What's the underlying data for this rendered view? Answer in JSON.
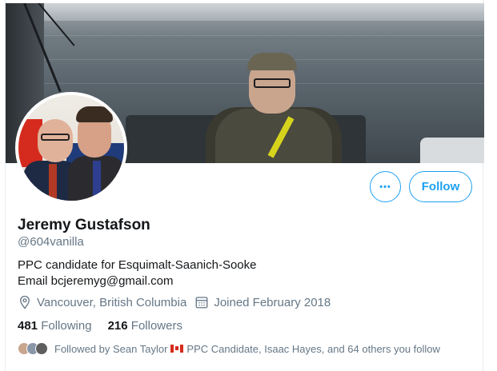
{
  "profile": {
    "display_name": "Jeremy Gustafson",
    "handle": "@604vanilla",
    "bio_line1": "PPC candidate for Esquimalt-Saanich-Sooke",
    "bio_line2": "Email bcjeremyg@gmail.com",
    "location": "Vancouver, British Columbia",
    "joined": "Joined February 2018"
  },
  "actions": {
    "more_label": "•••",
    "follow_label": "Follow"
  },
  "stats": {
    "following_count": "481",
    "following_label": "Following",
    "followers_count": "216",
    "followers_label": "Followers"
  },
  "followed_by": {
    "prefix": "Followed by Sean Taylor",
    "suffix": "PPC Candidate, Isaac Hayes, and 64 others you follow",
    "flag_icon": "canada-flag-icon"
  },
  "colors": {
    "accent": "#1da1f2",
    "secondary_text": "#657786",
    "primary_text": "#14171a"
  }
}
